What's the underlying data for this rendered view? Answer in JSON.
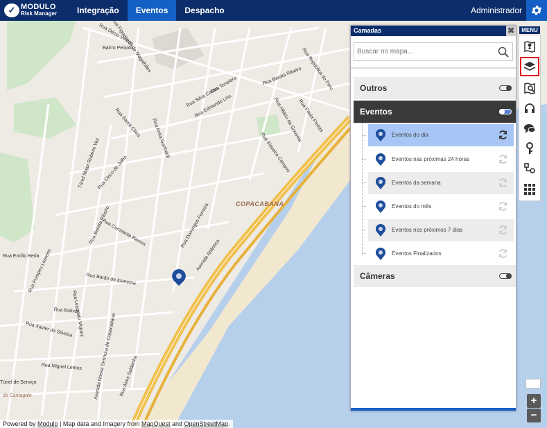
{
  "brand": {
    "line1": "MODULO",
    "line2": "Risk Manager"
  },
  "nav": [
    {
      "label": "Integração",
      "active": false
    },
    {
      "label": "Eventos",
      "active": true
    },
    {
      "label": "Despacho",
      "active": false
    }
  ],
  "user": "Administrador",
  "map": {
    "area_label": "COPACABANA",
    "streets": [
      "Rua Tonelero",
      "Rua Barata Ribeiro",
      "Rua República do Peru",
      "Rua Figueiredo de Magalhães",
      "Rua Silva Castro",
      "Rua Edmundo Lins",
      "Rua Santa Clara",
      "Rua Anita Garibaldi",
      "Rua Hilário de Gouveia",
      "Rua Paula Freitas",
      "Rua Siqueira Campos",
      "Túnel Major Rubens Vaz",
      "Rua Cinco de Julho",
      "Rua Barata Ribeiro",
      "Rua Domingos Ferreira",
      "Avenida Atlântica",
      "Rua Constante Ramos",
      "Rua Emílio Berla",
      "Rua Pompeu Loureiro",
      "Rua Barão de Ipanema",
      "Rua Bolívar",
      "Rua Leopoldo Miguez",
      "Avenida Nossa Senhora de Copacabana",
      "Rua Xavier da Silveira",
      "Rua Miguel Lemos",
      "Rua Aires Saldanha",
      "Túnel de Serviço",
      "do Cantagalo",
      "Bairro Peixoto",
      "Rua Décio Vilares",
      "Rua Anita Garibaldi"
    ],
    "attribution": {
      "prefix": "Powered by ",
      "modulo": "Modulo",
      "middle": " | Map data and Imagery from ",
      "mapquest": "MapQuest",
      "and": " and ",
      "osm": "OpenStreetMap",
      "suffix": "."
    }
  },
  "layers_panel": {
    "title": "Camadas",
    "close": "✖",
    "search_placeholder": "Buscar no mapa...",
    "groups": {
      "outros": {
        "label": "Outros",
        "enabled": false
      },
      "eventos": {
        "label": "Eventos",
        "enabled": true
      },
      "cameras": {
        "label": "Câmeras",
        "enabled": false
      }
    },
    "event_layers": [
      {
        "label": "Eventos do dia",
        "selected": true
      },
      {
        "label": "Eventos nas próximas 24 horas",
        "selected": false
      },
      {
        "label": "Eventos da semana",
        "selected": false
      },
      {
        "label": "Eventos do mês",
        "selected": false
      },
      {
        "label": "Eventos nos próximos 7 dias",
        "selected": false
      },
      {
        "label": "Eventos Finalizados",
        "selected": false
      }
    ]
  },
  "side_menu": {
    "title": "MENU",
    "items": [
      "map-pin-icon",
      "layers-icon",
      "search-map-icon",
      "headset-icon",
      "chat-icon",
      "key-icon",
      "route-icon",
      "grid-icon"
    ],
    "active_item": "layers-icon"
  },
  "zoom": {
    "in": "+",
    "out": "−"
  }
}
